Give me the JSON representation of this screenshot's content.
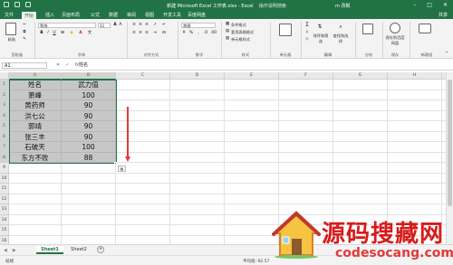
{
  "window": {
    "title": "新建 Microsoft Excel 工作表.xlsx - Excel",
    "search_placeholder": "操作说明搜索",
    "user": "m 孜枫",
    "share": "共享"
  },
  "ribbon_tabs": [
    "文件",
    "开始",
    "插入",
    "页面布局",
    "公式",
    "数据",
    "审阅",
    "视图",
    "开发工具",
    "百度网盘"
  ],
  "active_tab": "开始",
  "ribbon": {
    "clipboard": {
      "paste": "粘贴",
      "label": "剪贴板"
    },
    "font": {
      "name": "等线",
      "size": "11",
      "label": "字体"
    },
    "alignment": {
      "label": "对齐方式"
    },
    "number": {
      "format": "常规",
      "label": "数字"
    },
    "styles": {
      "conditional": "条件格式",
      "table": "套用表格格式",
      "cell": "单元格样式",
      "label": "样式"
    },
    "cells": {
      "label": "单元格"
    },
    "editing": {
      "label": "编辑"
    },
    "sort_filter": "排序和筛选",
    "find_select": "查找和选择",
    "analysis": {
      "label": "分析"
    },
    "save": {
      "button": "保存到百度网盘",
      "label": "保存"
    },
    "new_group": {
      "label": "新建组"
    }
  },
  "formula_bar": {
    "cell_ref": "A1",
    "formula": "姓名"
  },
  "columns": [
    "A",
    "B",
    "C",
    "D",
    "E",
    "F",
    "G",
    "H",
    "I",
    "J"
  ],
  "rows": [
    "1",
    "2",
    "3",
    "4",
    "5",
    "6",
    "7",
    "8",
    "9",
    "10",
    "11",
    "12",
    "13",
    "14",
    "15",
    "16"
  ],
  "table": [
    [
      "姓名",
      "武力值"
    ],
    [
      "萧峰",
      "100"
    ],
    [
      "黄药师",
      "90"
    ],
    [
      "洪七公",
      "90"
    ],
    [
      "郭靖",
      "90"
    ],
    [
      "张三丰",
      "90"
    ],
    [
      "石破天",
      "100"
    ],
    [
      "东方不败",
      "88"
    ]
  ],
  "sheets": [
    "Sheet1",
    "Sheet2"
  ],
  "active_sheet": "Sheet1",
  "status": {
    "ready": "就绪",
    "average": "平均值: 92.57"
  },
  "watermark": {
    "cn": "源码搜藏网",
    "en": "codesocang.com"
  },
  "colors": {
    "excel_green": "#217346",
    "arrow": "#e53935",
    "watermark": "#d81b1b"
  }
}
